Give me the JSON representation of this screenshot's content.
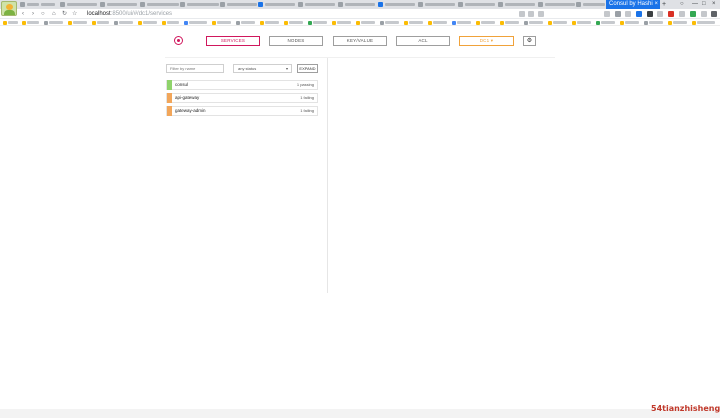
{
  "browser": {
    "active_tab_title": "Consul by Hashi",
    "active_tab_close": "×",
    "new_tab": "+",
    "url_host": "localhost",
    "url_path": ":8500/ui/#/dc1/services",
    "window_controls": {
      "account": "○",
      "minimize": "—",
      "maximize": "□",
      "close": "×"
    }
  },
  "header": {
    "tabs": [
      {
        "label": "SERVICES"
      },
      {
        "label": "NODES"
      },
      {
        "label": "KEY/VALUE"
      },
      {
        "label": "ACL"
      },
      {
        "label": "DC1 ▾"
      }
    ]
  },
  "filters": {
    "search_placeholder": "Filter by name",
    "status_value": "any status",
    "expand_label": "EXPAND"
  },
  "services": [
    {
      "name": "consul",
      "count": "1 passing",
      "status_color": "#8fd36b"
    },
    {
      "name": "api-gateway",
      "count": "1 failing",
      "status_color": "#f2a65a"
    },
    {
      "name": "gateway-admin",
      "count": "1 failing",
      "status_color": "#f2a65a"
    }
  ],
  "colors": {
    "brand": "#d0175d",
    "passing": "#8fd36b",
    "failing": "#f2a65a",
    "datacenter": "#f0a23a"
  },
  "watermark": "54tianzhisheng.cn"
}
